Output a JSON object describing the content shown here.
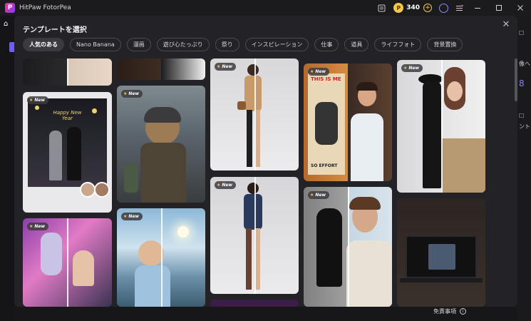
{
  "app": {
    "title": "HitPaw FotorPea",
    "logo_letter": "P",
    "credits": "340"
  },
  "modal": {
    "title": "テンプレートを選択",
    "close_glyph": "✕",
    "tabs": [
      {
        "label": "人気のある",
        "active": true
      },
      {
        "label": "Nano Banana",
        "active": false
      },
      {
        "label": "漫画",
        "active": false
      },
      {
        "label": "遊び心たっぷり",
        "active": false
      },
      {
        "label": "祭り",
        "active": false
      },
      {
        "label": "インスピレーション",
        "active": false
      },
      {
        "label": "仕事",
        "active": false
      },
      {
        "label": "道具",
        "active": false
      },
      {
        "label": "ライフフォト",
        "active": false
      },
      {
        "label": "背景置換",
        "active": false
      }
    ],
    "new_badge": "New",
    "cards": {
      "newyear_text": "Happy New Year",
      "poster_text": "THIS IS ME",
      "poster_text2": "SO EFFORT"
    }
  },
  "right_panel": {
    "item1": "像へ",
    "item2": "ント"
  },
  "footer": {
    "disclaimer": "免責事項"
  },
  "colors": {
    "accent": "#6d5cff",
    "coin": "#f5c84c",
    "modal_bg": "#232327"
  }
}
